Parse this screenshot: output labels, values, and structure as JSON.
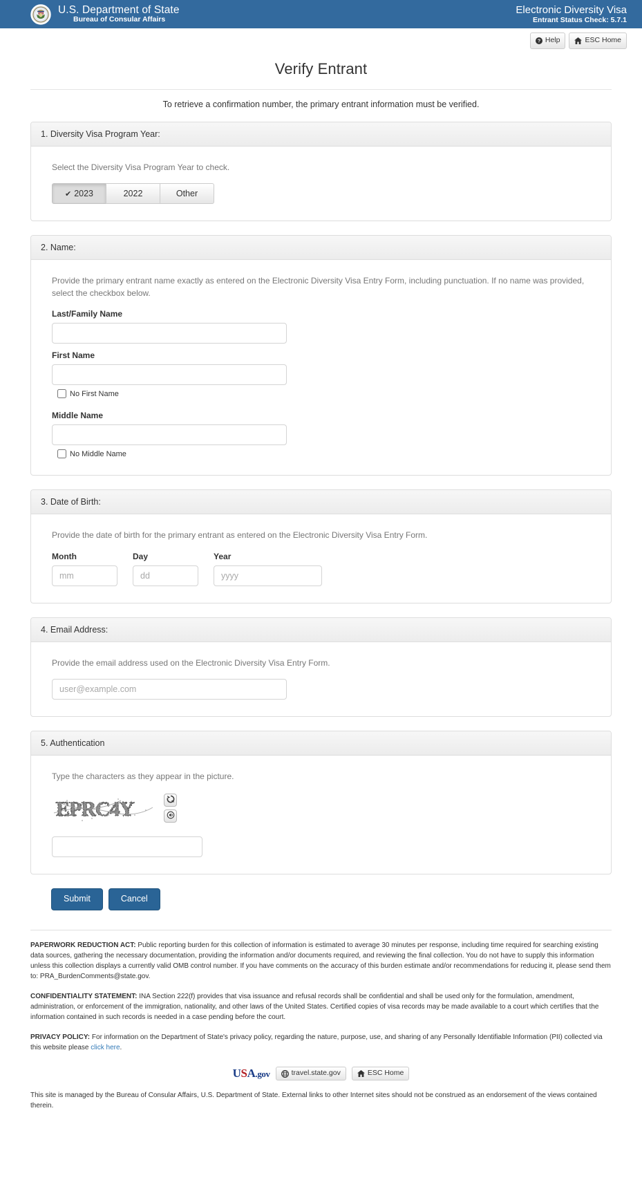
{
  "banner": {
    "seal_icon": "state-department-seal",
    "department": "U.S. Department of State",
    "bureau": "Bureau of Consular Affairs",
    "app_title": "Electronic Diversity Visa",
    "app_version": "Entrant Status Check: 5.7.1",
    "bg_color": "#336a9e"
  },
  "utilbar": {
    "help_label": "Help",
    "help_icon": "question-circle-icon",
    "esc_home_label": "ESC Home",
    "esc_home_icon": "home-icon"
  },
  "page": {
    "title": "Verify Entrant",
    "intro": "To retrieve a confirmation number, the primary entrant information must be verified."
  },
  "section_year": {
    "heading": "1. Diversity Visa Program Year:",
    "helper": "Select the Diversity Visa Program Year to check.",
    "options": [
      {
        "label": "2023",
        "selected": true
      },
      {
        "label": "2022",
        "selected": false
      },
      {
        "label": "Other",
        "selected": false
      }
    ],
    "check_glyph": "✔"
  },
  "section_name": {
    "heading": "2. Name:",
    "helper": "Provide the primary entrant name exactly as entered on the Electronic Diversity Visa Entry Form, including punctuation. If no name was provided, select the checkbox below.",
    "last_label": "Last/Family Name",
    "last_value": "",
    "first_label": "First Name",
    "first_value": "",
    "no_first_label": "No First Name",
    "no_first_checked": false,
    "middle_label": "Middle Name",
    "middle_value": "",
    "no_middle_label": "No Middle Name",
    "no_middle_checked": false
  },
  "section_dob": {
    "heading": "3. Date of Birth:",
    "helper": "Provide the date of birth for the primary entrant as entered on the Electronic Diversity Visa Entry Form.",
    "month_label": "Month",
    "month_placeholder": "mm",
    "month_value": "",
    "day_label": "Day",
    "day_placeholder": "dd",
    "day_value": "",
    "year_label": "Year",
    "year_placeholder": "yyyy",
    "year_value": ""
  },
  "section_email": {
    "heading": "4. Email Address:",
    "helper": "Provide the email address used on the Electronic Diversity Visa Entry Form.",
    "placeholder": "user@example.com",
    "value": ""
  },
  "section_auth": {
    "heading": "5. Authentication",
    "helper": "Type the characters as they appear in the picture.",
    "captcha_text": "EPRC4Y",
    "captcha_image_name": "captcha-image",
    "refresh_icon": "refresh-icon",
    "audio_icon": "audio-speaker-icon",
    "input_value": ""
  },
  "actions": {
    "submit_label": "Submit",
    "cancel_label": "Cancel",
    "primary_color": "#2a6496"
  },
  "legal": {
    "paperwork_title": "PAPERWORK REDUCTION ACT:",
    "paperwork_text": " Public reporting burden for this collection of information is estimated to average 30 minutes per response, including time required for searching existing data sources, gathering the necessary documentation, providing the information and/or documents required, and reviewing the final collection. You do not have to supply this information unless this collection displays a currently valid OMB control number. If you have comments on the accuracy of this burden estimate and/or recommendations for reducing it, please send them to: PRA_BurdenComments@state.gov.",
    "confidentiality_title": "CONFIDENTIALITY STATEMENT:",
    "confidentiality_text": " INA Section 222(f) provides that visa issuance and refusal records shall be confidential and shall be used only for the formulation, amendment, administration, or enforcement of the immigration, nationality, and other laws of the United States. Certified copies of visa records may be made available to a court which certifies that the information contained in such records is needed in a case pending before the court.",
    "privacy_title": "PRIVACY POLICY:",
    "privacy_text": " For information on the Department of State's privacy policy, regarding the nature, purpose, use, and sharing of any Personally Identifiable Information (PII) collected via this website please ",
    "privacy_link": "click here",
    "privacy_tail": "."
  },
  "footer": {
    "usagov_u": "U",
    "usagov_s": "S",
    "usagov_a": "A",
    "usagov_dotgov": ".gov",
    "travel_label": "travel.state.gov",
    "travel_icon": "globe-icon",
    "esc_home_label": "ESC Home",
    "esc_home_icon": "home-icon",
    "note": "This site is managed by the Bureau of Consular Affairs, U.S. Department of State. External links to other Internet sites should not be construed as an endorsement of the views contained therein."
  }
}
